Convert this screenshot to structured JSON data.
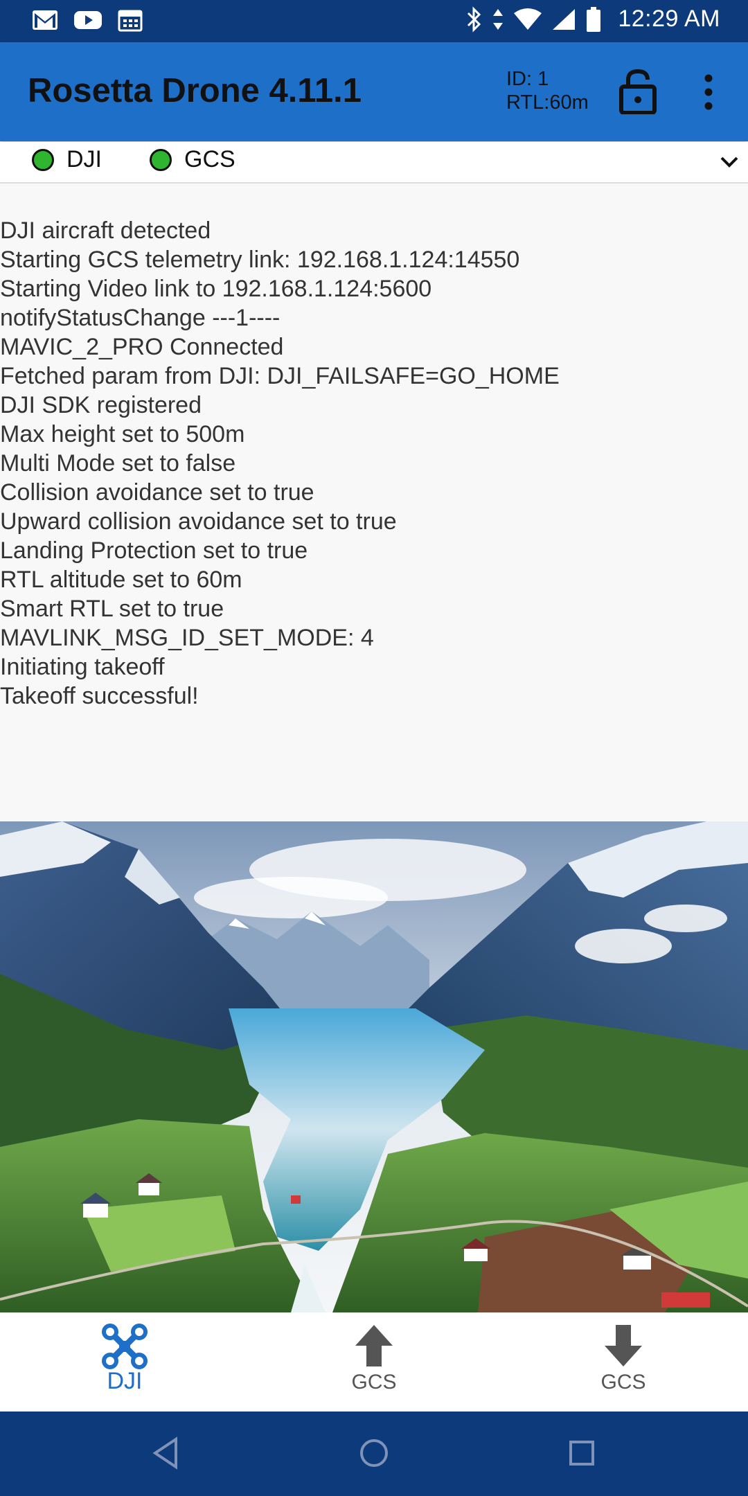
{
  "status_bar": {
    "time": "12:29 AM",
    "left_icons": [
      "gmail-icon",
      "youtube-icon",
      "calendar-icon"
    ],
    "right_icons": [
      "bluetooth-icon",
      "wifi-icon",
      "signal-icon",
      "battery-icon"
    ]
  },
  "app_bar": {
    "title": "Rosetta Drone 4.11.1",
    "id_label": "ID: 1",
    "rtl_label": "RTL:60m",
    "lock_icon": "lock-open-icon",
    "menu_icon": "more-vert-icon"
  },
  "connections": [
    {
      "label": "DJI",
      "status_color": "#2fb52f"
    },
    {
      "label": "GCS",
      "status_color": "#2fb52f"
    }
  ],
  "log_lines": [
    "DJI aircraft detected",
    "Starting GCS telemetry link: 192.168.1.124:14550",
    "Starting Video link to 192.168.1.124:5600",
    "notifyStatusChange ---1----",
    "MAVIC_2_PRO Connected",
    "Fetched param from DJI: DJI_FAILSAFE=GO_HOME",
    "DJI SDK registered",
    "Max height set to 500m",
    "Multi Mode set to false",
    "Collision avoidance set to true",
    "Upward collision avoidance set to true",
    "Landing Protection set to true",
    "RTL altitude set to 60m",
    "Smart RTL set to true",
    "MAVLINK_MSG_ID_SET_MODE: 4",
    "Initiating takeoff",
    "Takeoff successful!"
  ],
  "bottom_nav": [
    {
      "label": "DJI",
      "icon": "drone-icon",
      "active": true
    },
    {
      "label": "GCS",
      "icon": "arrow-up-icon",
      "active": false
    },
    {
      "label": "GCS",
      "icon": "arrow-down-icon",
      "active": false
    }
  ],
  "system_nav": [
    "back-icon",
    "home-icon",
    "recents-icon"
  ],
  "colors": {
    "status_bar": "#0d3a7a",
    "app_bar": "#1e6fc8",
    "accent": "#1e6fc8",
    "connected_dot": "#2fb52f"
  }
}
